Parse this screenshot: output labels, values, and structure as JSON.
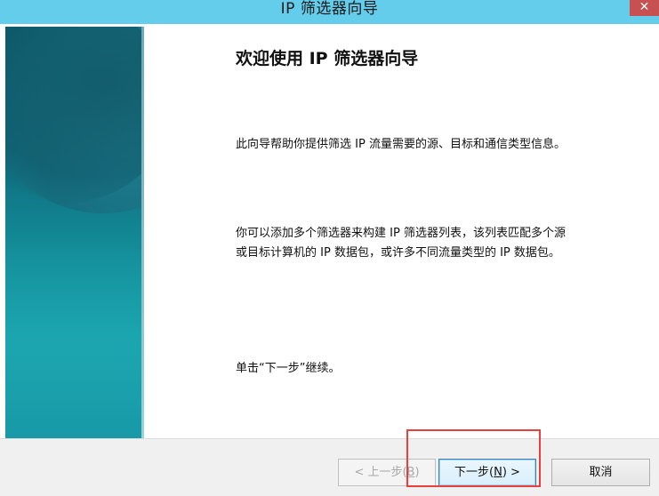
{
  "window": {
    "title": "IP 筛选器向导",
    "close_glyph": "✕"
  },
  "wizard": {
    "heading": "欢迎使用 IP 筛选器向导",
    "para1": "此向导帮助你提供筛选 IP 流量需要的源、目标和通信类型信息。",
    "para2_line1": "你可以添加多个筛选器来构建 IP 筛选器列表，该列表匹配多个源",
    "para2_line2": "或目标计算机的 IP 数据包，或许多不同流量类型的 IP 数据包。",
    "para3": "单击“下一步”继续。"
  },
  "buttons": {
    "back": {
      "prefix": "< 上一步(",
      "key": "B",
      "suffix": ")",
      "enabled": false
    },
    "next": {
      "prefix": "下一步(",
      "key": "N",
      "suffix": ") >",
      "enabled": true
    },
    "cancel": {
      "label": "取消"
    }
  },
  "colors": {
    "titlebar": "#64cdeb",
    "highlight": "#e8403e",
    "side_panel": "#0f6b7c"
  }
}
